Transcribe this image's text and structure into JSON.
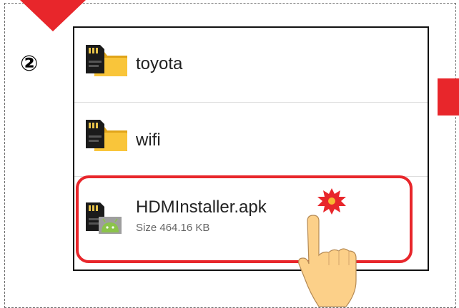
{
  "step": {
    "badge": "②"
  },
  "colors": {
    "accent": "#e8262b",
    "folder": "#f9c53a",
    "android": "#8bc34a"
  },
  "files": [
    {
      "name": "toyota",
      "icon": "sd-folder-icon"
    },
    {
      "name": "wifi",
      "icon": "sd-folder-icon"
    },
    {
      "name": "HDMInstaller.apk",
      "size": "Size 464.16 KB",
      "icon": "apk-file-icon",
      "highlighted": true
    }
  ],
  "pointer": {
    "icon": "tapping-hand-icon"
  }
}
